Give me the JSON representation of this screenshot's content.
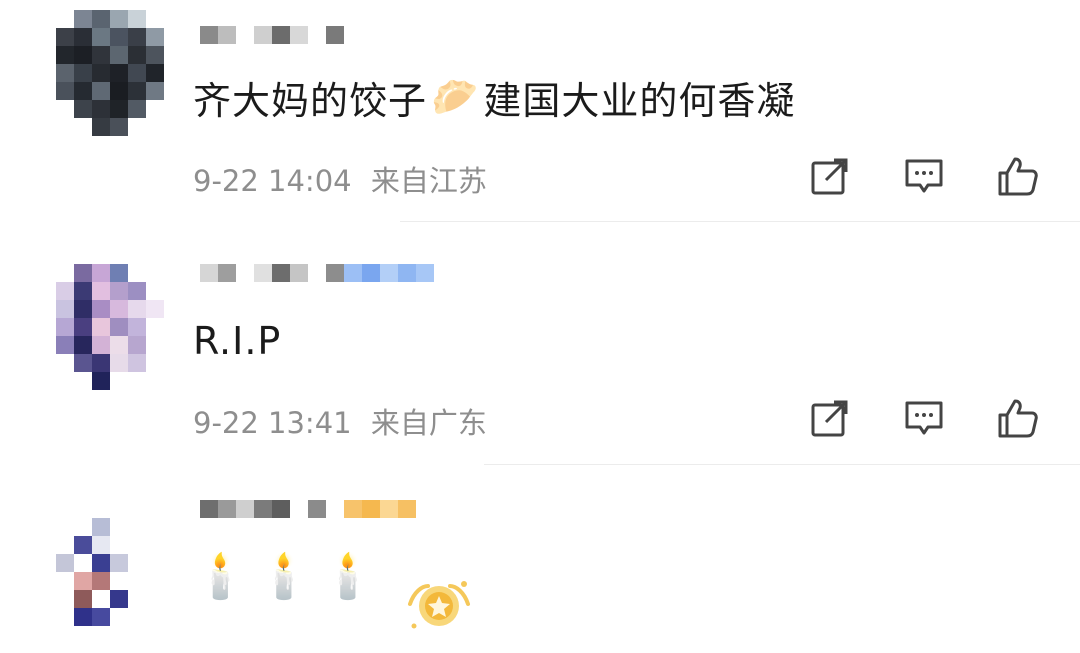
{
  "comments": [
    {
      "text_a": "齐大妈的饺子",
      "emoji": "🥟",
      "text_b": "建国大业的何香凝",
      "time": "9-22 14:04",
      "location": "来自江苏"
    },
    {
      "text": "R.I.P",
      "time": "9-22 13:41",
      "location": "来自广东"
    },
    {
      "candles": [
        "🕯️",
        "🕯️",
        "🕯️"
      ]
    }
  ],
  "icons": {
    "repost": "share-square-icon",
    "comment": "comment-bubble-icon",
    "like": "thumbs-up-icon"
  },
  "colors": {
    "text": "#1b1b1b",
    "meta": "#8e8e8e",
    "icon": "#444444",
    "divider": "#ececec"
  }
}
